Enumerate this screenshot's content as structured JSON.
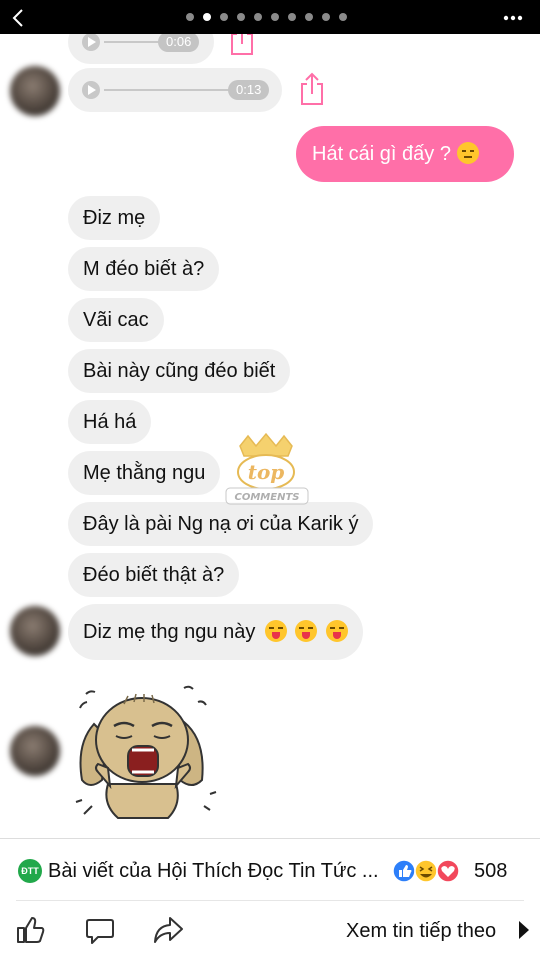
{
  "header": {
    "back_icon": "chevron-left-icon",
    "page_count": 10,
    "active_page": 2,
    "more_icon": "more-horizontal-icon"
  },
  "chat": {
    "audio_messages": [
      {
        "duration": "0:06"
      },
      {
        "duration": "0:13"
      }
    ],
    "outgoing": [
      {
        "text": "Hát cái gì đấy ?",
        "emoji": "expressionless-face"
      }
    ],
    "incoming": [
      {
        "text": "Điz mẹ"
      },
      {
        "text": "M đéo biết à?"
      },
      {
        "text": "Vãi cac"
      },
      {
        "text": "Bài này cũng đéo biết"
      },
      {
        "text": "Há há"
      },
      {
        "text": "Mẹ thằng ngu"
      },
      {
        "text": "Đây là pài Ng nạ ơi của Karik ý"
      },
      {
        "text": "Đéo biết thật à?"
      },
      {
        "text": "Diz mẹ thg ngu này",
        "emoji": "face-with-tongue x3"
      }
    ],
    "watermark_logo": "top COMMENTS",
    "sticker": "crying-dog-sticker",
    "colors": {
      "outgoing_bubble": "#ff6fa8",
      "incoming_bubble": "#efefef"
    }
  },
  "footer": {
    "group_badge": "ĐTT",
    "post_title": "Bài viết của Hội Thích Đọc Tin Tức ...",
    "reaction_icons": [
      "like-icon",
      "haha-icon",
      "love-icon"
    ],
    "reaction_count": "508",
    "actions": [
      "like-icon",
      "comment-icon",
      "share-icon"
    ],
    "next_label": "Xem tin tiếp theo"
  }
}
